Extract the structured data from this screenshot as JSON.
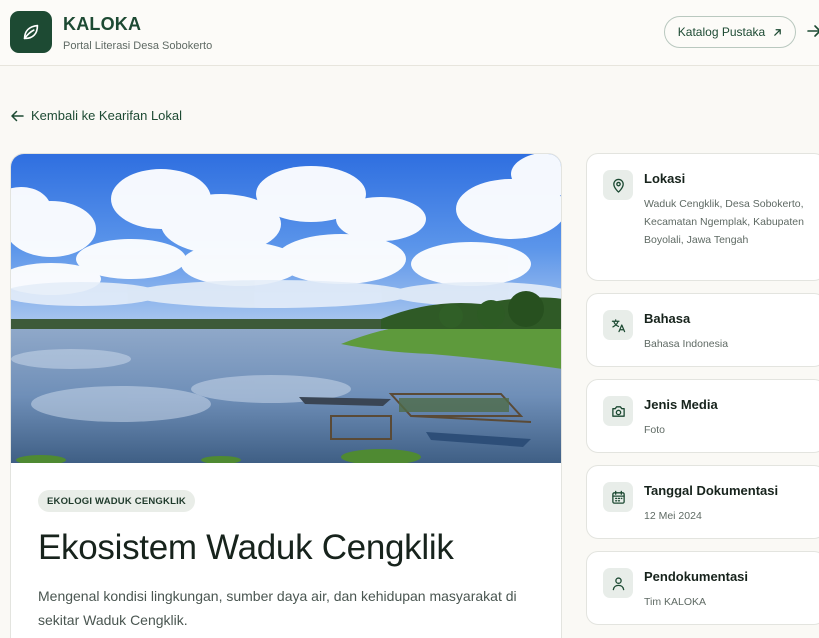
{
  "brand": {
    "name": "KALOKA",
    "subtitle": "Portal Literasi Desa Sobokerto",
    "logo_icon": "leaf-icon"
  },
  "header": {
    "catalog_label": "Katalog Pustaka",
    "catalog_icon": "arrow-up-right-icon",
    "login_icon": "arrow-right-icon"
  },
  "nav": {
    "back_label": "Kembali ke Kearifan Lokal"
  },
  "article": {
    "badge": "EKOLOGI WADUK CENGKLIK",
    "title": "Ekosistem Waduk Cengklik",
    "description": "Mengenal kondisi lingkungan, sumber daya air, dan kehidupan masyarakat di sekitar Waduk Cengklik."
  },
  "info": [
    {
      "label": "Lokasi",
      "value": "Waduk Cengklik, Desa Sobokerto, Kecamatan Ngemplak, Kabupaten Boyolali, Jawa Tengah",
      "icon": "map-pin-icon"
    },
    {
      "label": "Bahasa",
      "value": "Bahasa Indonesia",
      "icon": "translate-icon"
    },
    {
      "label": "Jenis Media",
      "value": "Foto",
      "icon": "camera-icon"
    },
    {
      "label": "Tanggal Dokumentasi",
      "value": "12 Mei 2024",
      "icon": "calendar-icon"
    },
    {
      "label": "Pendokumentasi",
      "value": "Tim KALOKA",
      "icon": "user-icon"
    }
  ],
  "colors": {
    "brand_green": "#1d4a33",
    "background": "#faf9f5",
    "card": "#ffffff"
  }
}
